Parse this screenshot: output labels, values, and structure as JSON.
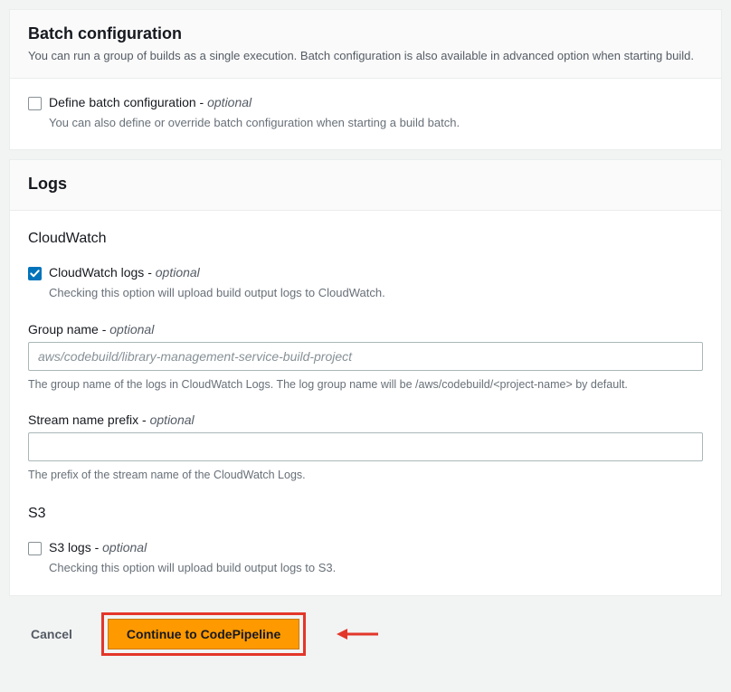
{
  "batch": {
    "title": "Batch configuration",
    "desc": "You can run a group of builds as a single execution. Batch configuration is also available in advanced option when starting build.",
    "define_label": "Define batch configuration - ",
    "define_optional": "optional",
    "define_desc": "You can also define or override batch configuration when starting a build batch."
  },
  "logs": {
    "title": "Logs",
    "cloudwatch_heading": "CloudWatch",
    "cw_label": "CloudWatch logs - ",
    "cw_optional": "optional",
    "cw_desc": "Checking this option will upload build output logs to CloudWatch.",
    "group_label": "Group name - ",
    "group_optional": "optional",
    "group_placeholder": "aws/codebuild/library-management-service-build-project",
    "group_help": "The group name of the logs in CloudWatch Logs. The log group name will be /aws/codebuild/<project-name> by default.",
    "stream_label": "Stream name prefix - ",
    "stream_optional": "optional",
    "stream_help": "The prefix of the stream name of the CloudWatch Logs.",
    "s3_heading": "S3",
    "s3_label": "S3 logs - ",
    "s3_optional": "optional",
    "s3_desc": "Checking this option will upload build output logs to S3."
  },
  "actions": {
    "cancel": "Cancel",
    "continue": "Continue to CodePipeline"
  },
  "colors": {
    "primary_btn": "#ff9900",
    "highlight_border": "#e3362a",
    "checkbox_checked": "#0073bb"
  }
}
